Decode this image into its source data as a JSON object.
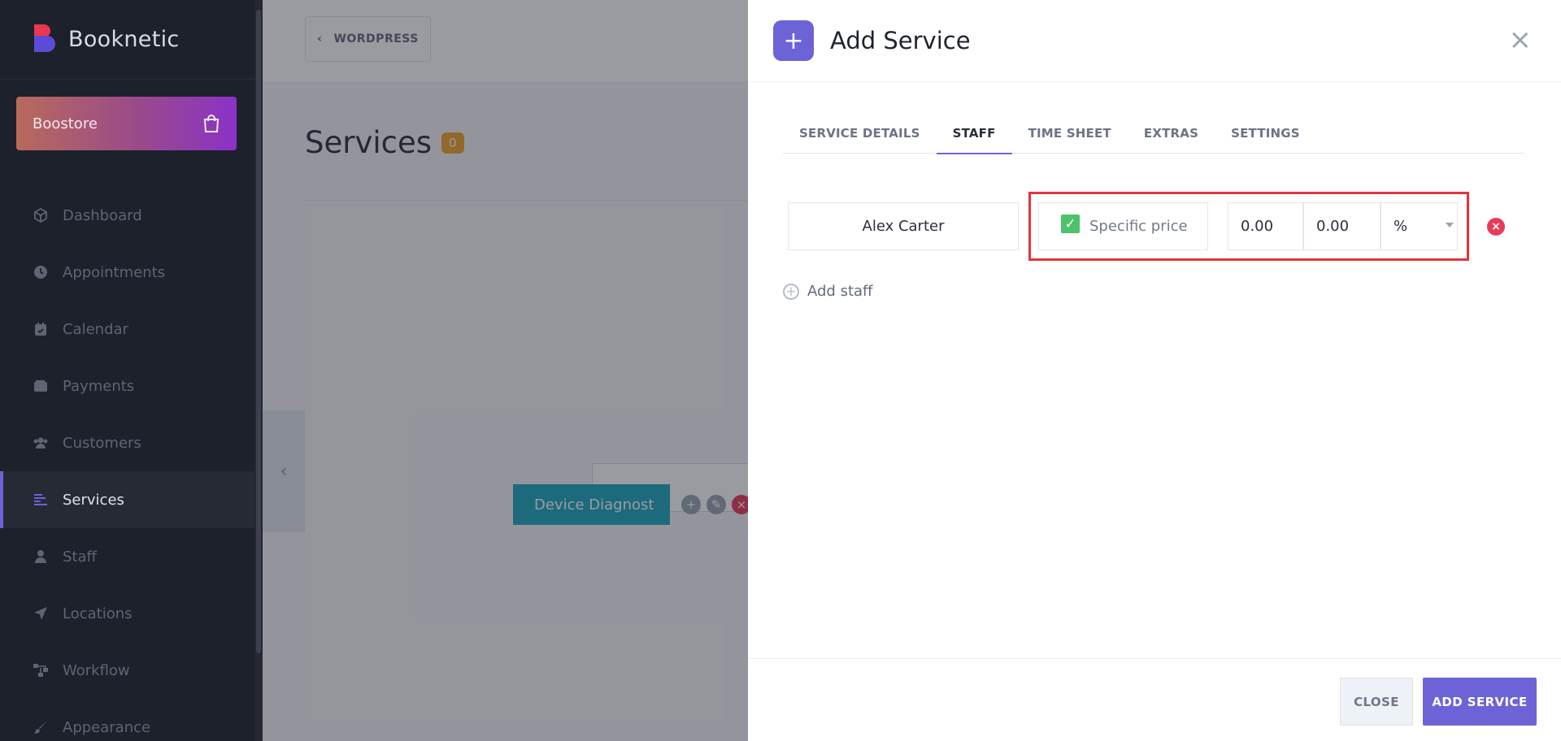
{
  "brand": {
    "name": "Booknetic"
  },
  "boostore": {
    "label": "Boostore",
    "icon": "shopping-bag-icon"
  },
  "sidebar": {
    "items": [
      {
        "label": "Dashboard",
        "icon": "cube-icon"
      },
      {
        "label": "Appointments",
        "icon": "clock-icon"
      },
      {
        "label": "Calendar",
        "icon": "calendar-icon"
      },
      {
        "label": "Payments",
        "icon": "wallet-icon"
      },
      {
        "label": "Customers",
        "icon": "users-icon"
      },
      {
        "label": "Services",
        "icon": "list-icon",
        "active": true
      },
      {
        "label": "Staff",
        "icon": "user-icon"
      },
      {
        "label": "Locations",
        "icon": "location-arrow-icon"
      },
      {
        "label": "Workflow",
        "icon": "workflow-icon"
      },
      {
        "label": "Appearance",
        "icon": "brush-icon"
      }
    ]
  },
  "background": {
    "wordpress_label": "WORDPRESS",
    "page_title": "Services",
    "count": "0",
    "service_button": "Device Diagnost"
  },
  "modal": {
    "title": "Add Service",
    "tabs": [
      {
        "label": "SERVICE DETAILS"
      },
      {
        "label": "STAFF",
        "active": true
      },
      {
        "label": "TIME SHEET"
      },
      {
        "label": "EXTRAS"
      },
      {
        "label": "SETTINGS"
      }
    ],
    "staff_row": {
      "name": "Alex Carter",
      "specific_price_label": "Specific price",
      "specific_price_checked": true,
      "price": "0.00",
      "deposit": "0.00",
      "deposit_type": "%"
    },
    "add_staff_label": "Add staff",
    "close_label": "CLOSE",
    "submit_label": "ADD SERVICE"
  },
  "colors": {
    "accent": "#6c63d7",
    "highlight": "#e3343b",
    "check": "#4cc36a",
    "danger": "#ea3a5a",
    "service_teal": "#1aa6bd",
    "badge": "#f0a32b"
  }
}
